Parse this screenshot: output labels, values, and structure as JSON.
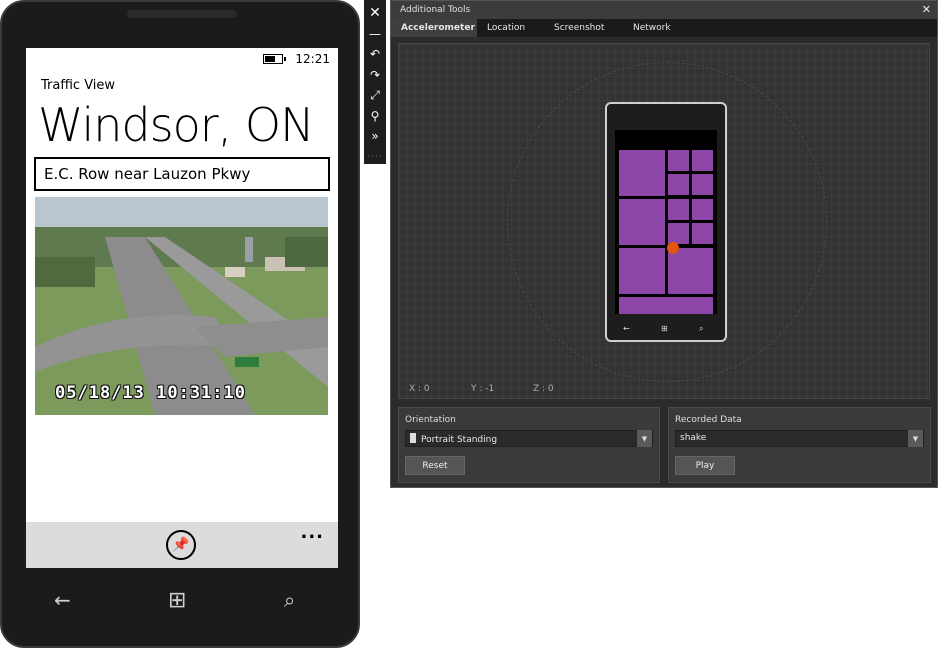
{
  "phone": {
    "status_time": "12:21",
    "app_title": "Traffic View",
    "page_title": "Windsor, ON",
    "camera_name": "E.C. Row near Lauzon Pkwy",
    "camera_timestamp": "05/18/13  10:31:10",
    "app_bar": {
      "pin_icon": "pin-icon",
      "more_label": "..."
    },
    "hardware_buttons": [
      "back-icon",
      "windows-start-icon",
      "search-icon"
    ]
  },
  "side_toolbar": {
    "buttons": [
      "close-icon",
      "minimize-icon",
      "rotate-left-icon",
      "rotate-right-icon",
      "fit-to-screen-icon",
      "zoom-icon",
      "additional-tools-icon"
    ]
  },
  "tools": {
    "title": "Additional Tools",
    "close_label": "✕",
    "tabs": [
      {
        "label": "Accelerometer",
        "active": true
      },
      {
        "label": "Location",
        "active": false
      },
      {
        "label": "Screenshot",
        "active": false
      },
      {
        "label": "Network",
        "active": false
      }
    ],
    "accelerometer": {
      "x_readout": "X : 0",
      "y_readout": "Y : -1",
      "z_readout": "Z : 0",
      "tile_color": "#8b46a8",
      "dot_color": "#e05510"
    },
    "orientation": {
      "label": "Orientation",
      "selected": "Portrait Standing",
      "reset_label": "Reset"
    },
    "recorded_data": {
      "label": "Recorded Data",
      "selected": "shake",
      "play_label": "Play"
    }
  }
}
